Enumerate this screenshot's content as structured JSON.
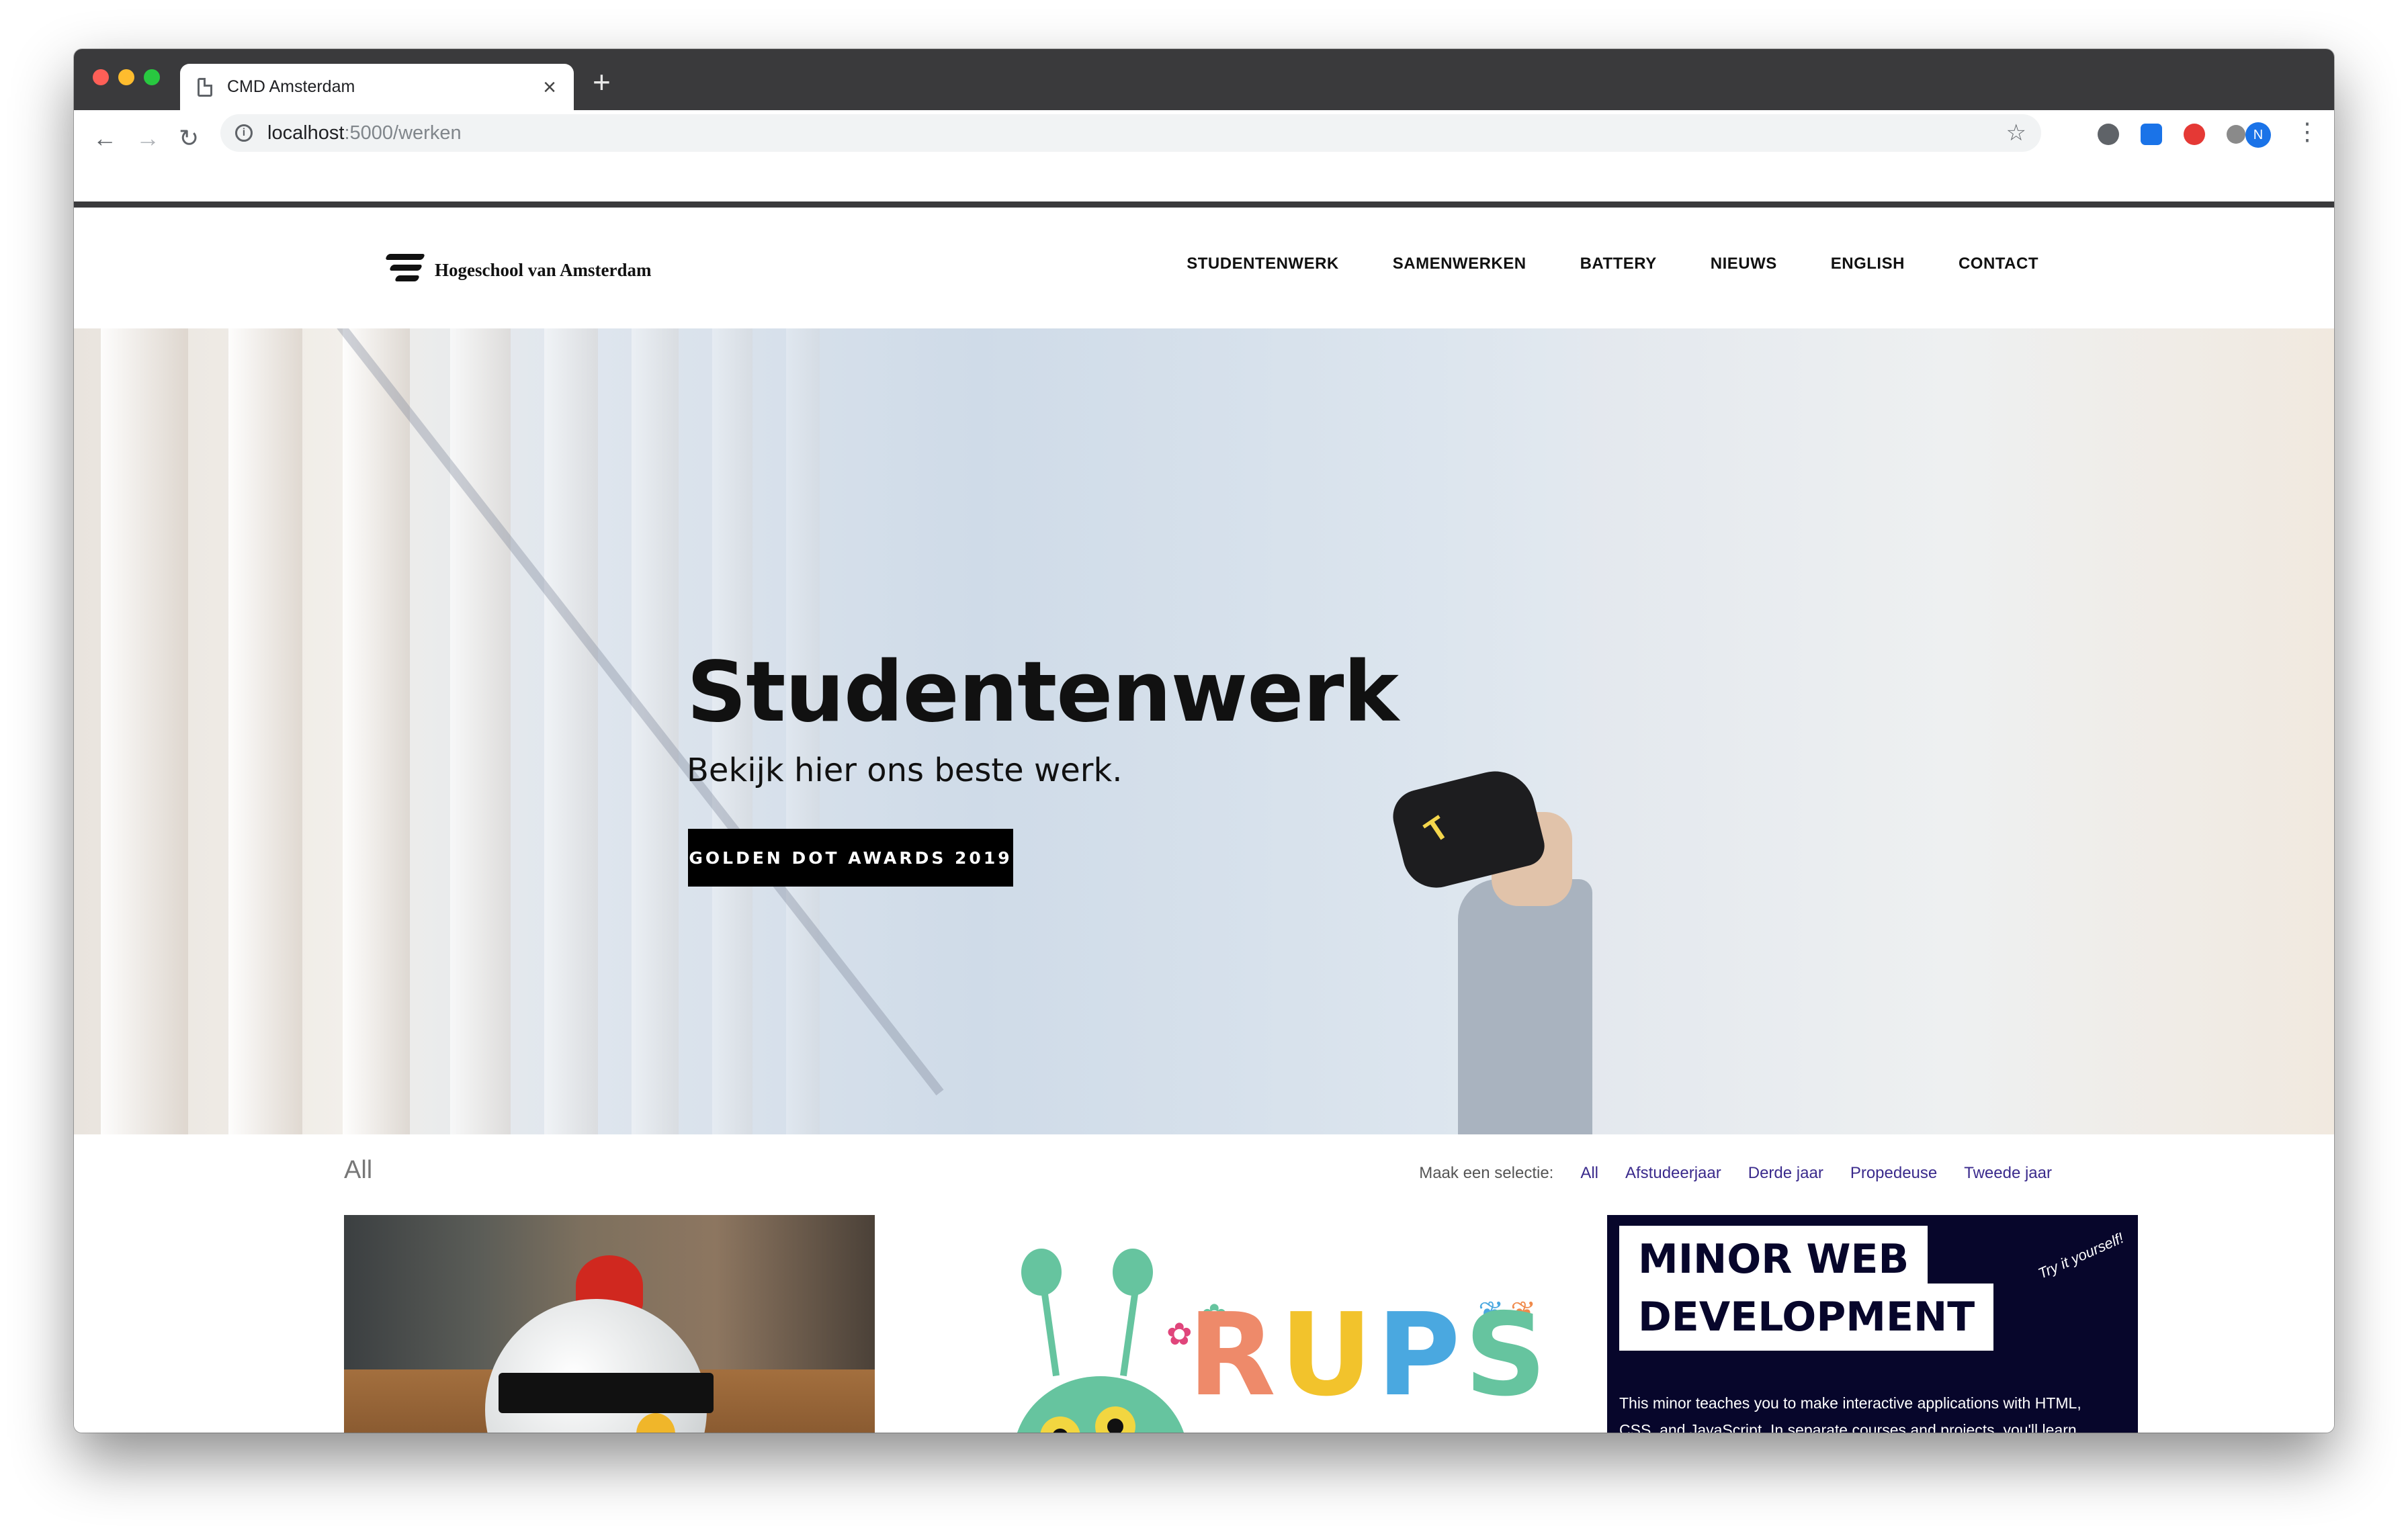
{
  "browser": {
    "tab_title": "CMD Amsterdam",
    "tab_close": "×",
    "new_tab": "+",
    "url_host": "localhost",
    "url_path": ":5000/werken",
    "avatar_initial": "N"
  },
  "site": {
    "logo_text": "Hogeschool van Amsterdam",
    "nav": [
      "STUDENTENWERK",
      "SAMENWERKEN",
      "BATTERY",
      "NIEUWS",
      "ENGLISH",
      "CONTACT"
    ]
  },
  "hero": {
    "title": "Studentenwerk",
    "subtitle": "Bekijk hier ons beste werk.",
    "button": "GOLDEN DOT AWARDS 2019",
    "headset_logo": "T"
  },
  "filter": {
    "title": "All",
    "label": "Maak een selectie:",
    "options": [
      "All",
      "Afstudeerjaar",
      "Derde jaar",
      "Propedeuse",
      "Tweede jaar"
    ]
  },
  "cards": {
    "card2_logo_letters": [
      "R",
      "U",
      "P",
      "S",
      "i",
      "e"
    ],
    "card3": {
      "title_line1": "MINOR WEB",
      "title_line2": "DEVELOPMENT",
      "tagline": "Try it yourself!",
      "description": "This minor teaches you to make interactive applications with HTML, CSS, and JavaScript. In separate courses and projects, you'll learn everything about: real-time web, internet of things, performance, rapid prototyping"
    }
  },
  "colors": {
    "accent_link": "#3a2a8c",
    "hero_button": "#000000",
    "minor_bg": "#07062b"
  }
}
